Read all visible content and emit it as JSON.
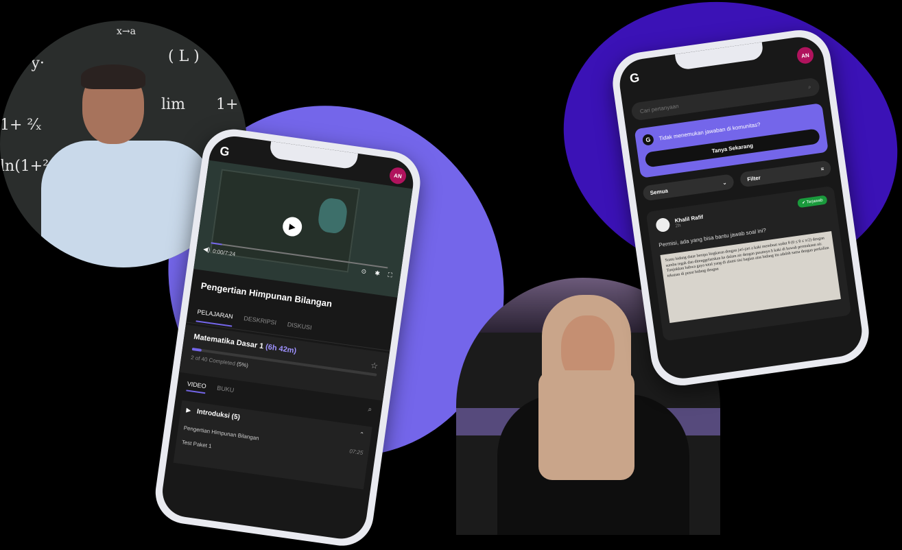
{
  "left_phone": {
    "avatar": "AN",
    "logo": "G",
    "timecode": "0:00/7:24",
    "lesson_title": "Pengertian Himpunan Bilangan",
    "tabs": [
      "PELAJARAN",
      "DESKRIPSI",
      "DISKUSI"
    ],
    "course": {
      "title": "Matematika Dasar 1",
      "duration": "(6h 42m)",
      "progress_text": "2 of 40 Completed",
      "progress_pct": "(5%)",
      "progress_value": 0.05
    },
    "subtabs": [
      "VIDEO",
      "BUKU"
    ],
    "section": {
      "title": "Introduksi (5)",
      "items": [
        {
          "label": "Pengertian Himpunan Bilangan",
          "time": "07:25"
        },
        {
          "label": "Test Paket 1",
          "time": ""
        }
      ]
    }
  },
  "right_phone": {
    "avatar": "AN",
    "logo": "G",
    "search_placeholder": "Cari pertanyaan",
    "ask_text": "Tidak menemukan jawaban di komunitas?",
    "ask_button": "Tanya Sekarang",
    "filter_left": "Semua",
    "filter_right": "Filter",
    "question": {
      "user": "Khalil Rafif",
      "time": "2h",
      "badge": "Terjawab",
      "text": "Permisi, ada yang bisa bantu jawab soal ini?",
      "image_text": "Suatu bidang datar berupa lingkaran dengan jari-jari a kaki membuat sudut θ (0 ≤ θ ≤ π/2) dengan sumbu tegak dan ditenggelamkan ke dalam air dengan pusatnya h kaki di bawah permukaan air. Tunjukkan bahwa gaya total yang di alami sisi bagian atas bidang itu adalah sama dengan perkalian tekanan di pusat bidang dengan"
    }
  },
  "colors": {
    "accent": "#7466ea",
    "deep_purple": "#3b12b6",
    "badge_green": "#1a9a3c",
    "avatar": "#b0135d"
  }
}
